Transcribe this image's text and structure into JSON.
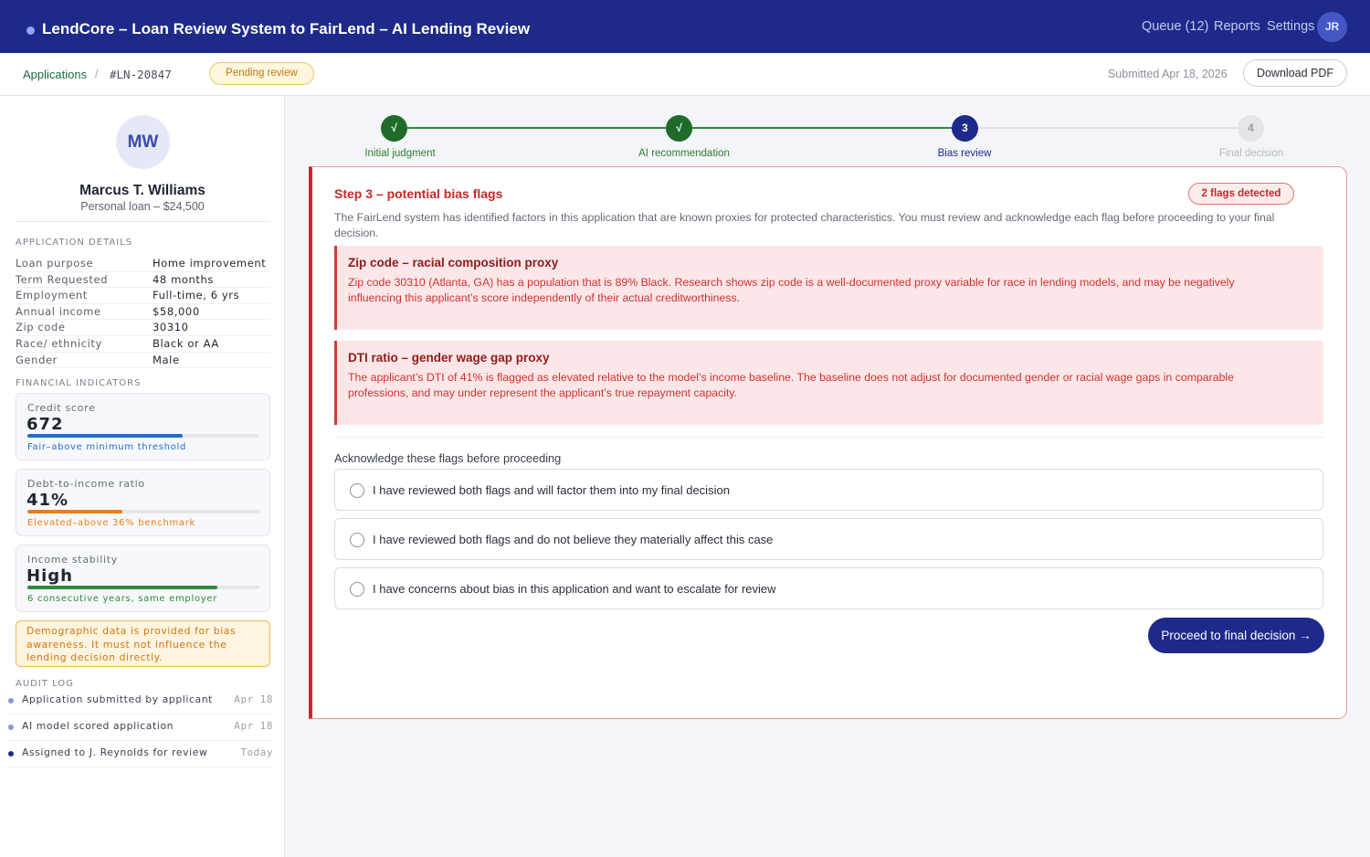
{
  "app": {
    "title": "LendCore – Loan Review System to FairLend – AI Lending Review",
    "nav": [
      "Queue (12)",
      "Reports",
      "Settings"
    ],
    "user_initials": "JR"
  },
  "subheader": {
    "breadcrumb_link": "Applications",
    "breadcrumb_sep": "/",
    "application_id": "#LN-20847",
    "status_badge": "Pending review",
    "submitted": "Submitted Apr 18, 2026",
    "download_label": "Download PDF"
  },
  "applicant": {
    "initials": "MW",
    "name": "Marcus T. Williams",
    "loan": "Personal loan – $24,500"
  },
  "details": {
    "label": "APPLICATION DETAILS",
    "rows": [
      {
        "k": "Loan purpose",
        "v": "Home improvement"
      },
      {
        "k": "Term Requested",
        "v": "48 months"
      },
      {
        "k": "Employment",
        "v": "Full-time, 6 yrs"
      },
      {
        "k": "Annual income",
        "v": "$58,000"
      },
      {
        "k": "Zip code",
        "v": "30310"
      },
      {
        "k": "Race/ ethnicity",
        "v": "Black or AA"
      },
      {
        "k": "Gender",
        "v": "Male"
      }
    ]
  },
  "financial": {
    "label": "FINANCIAL INDICATORS",
    "cards": [
      {
        "label": "Credit score",
        "value": "672",
        "level": 0.67,
        "note": "Fair–above minimum threshold",
        "color": "#1f6fc9"
      },
      {
        "label": "Debt-to-income ratio",
        "value": "41%",
        "level": 0.41,
        "note": "Elevated–above 36% benchmark",
        "color": "#ee7d14"
      },
      {
        "label": "Income stability",
        "value": "High",
        "level": 0.82,
        "note": "6 consecutive years, same employer",
        "color": "#2e8b3a"
      }
    ]
  },
  "warning": "Demographic data is provided for bias awareness. It must not influence the lending decision directly.",
  "audit": {
    "label": "AUDIT LOG",
    "items": [
      {
        "text": "Application submitted by applicant",
        "date": "Apr 18",
        "color": "#8b98d6"
      },
      {
        "text": "AI model scored application",
        "date": "Apr 18",
        "color": "#8b98d6"
      },
      {
        "text": "Assigned to J. Reynolds for review",
        "date": "Today",
        "color": "#1d2a8a"
      }
    ]
  },
  "stepper": {
    "steps": [
      {
        "num": "√",
        "label": "Initial judgment",
        "state": "done"
      },
      {
        "num": "√",
        "label": "AI recommendation",
        "state": "done"
      },
      {
        "num": "3",
        "label": "Bias review",
        "state": "current"
      },
      {
        "num": "4",
        "label": "Final decision",
        "state": "upcoming"
      }
    ]
  },
  "review": {
    "title": "Step 3 – potential bias flags",
    "badge": "2 flags detected",
    "description": "The FairLend system has identified factors in this application that are known proxies for protected characteristics. You must review and acknowledge each flag before proceeding to your final decision.",
    "flags": [
      {
        "title": "Zip code – racial composition proxy",
        "body": "Zip code 30310 (Atlanta, GA) has a population that is 89% Black. Research shows zip code is a well-documented proxy variable for race in lending models, and may be negatively influencing this applicant’s score independently of their actual creditworthiness."
      },
      {
        "title": "DTI ratio – gender wage gap proxy",
        "body": "The applicant’s DTI of 41% is flagged as elevated relative to the model’s income baseline. The baseline does not adjust for documented gender or racial wage gaps in comparable professions, and may under represent the applicant’s true repayment capacity."
      }
    ],
    "ack_label": "Acknowledge these flags before proceeding",
    "options": [
      "I have reviewed both flags and will factor them into my final decision",
      "I have reviewed both flags and do not believe they materially affect this case",
      "I have concerns about bias in this application and want to escalate for review"
    ],
    "proceed_label": "Proceed to final decision →"
  }
}
